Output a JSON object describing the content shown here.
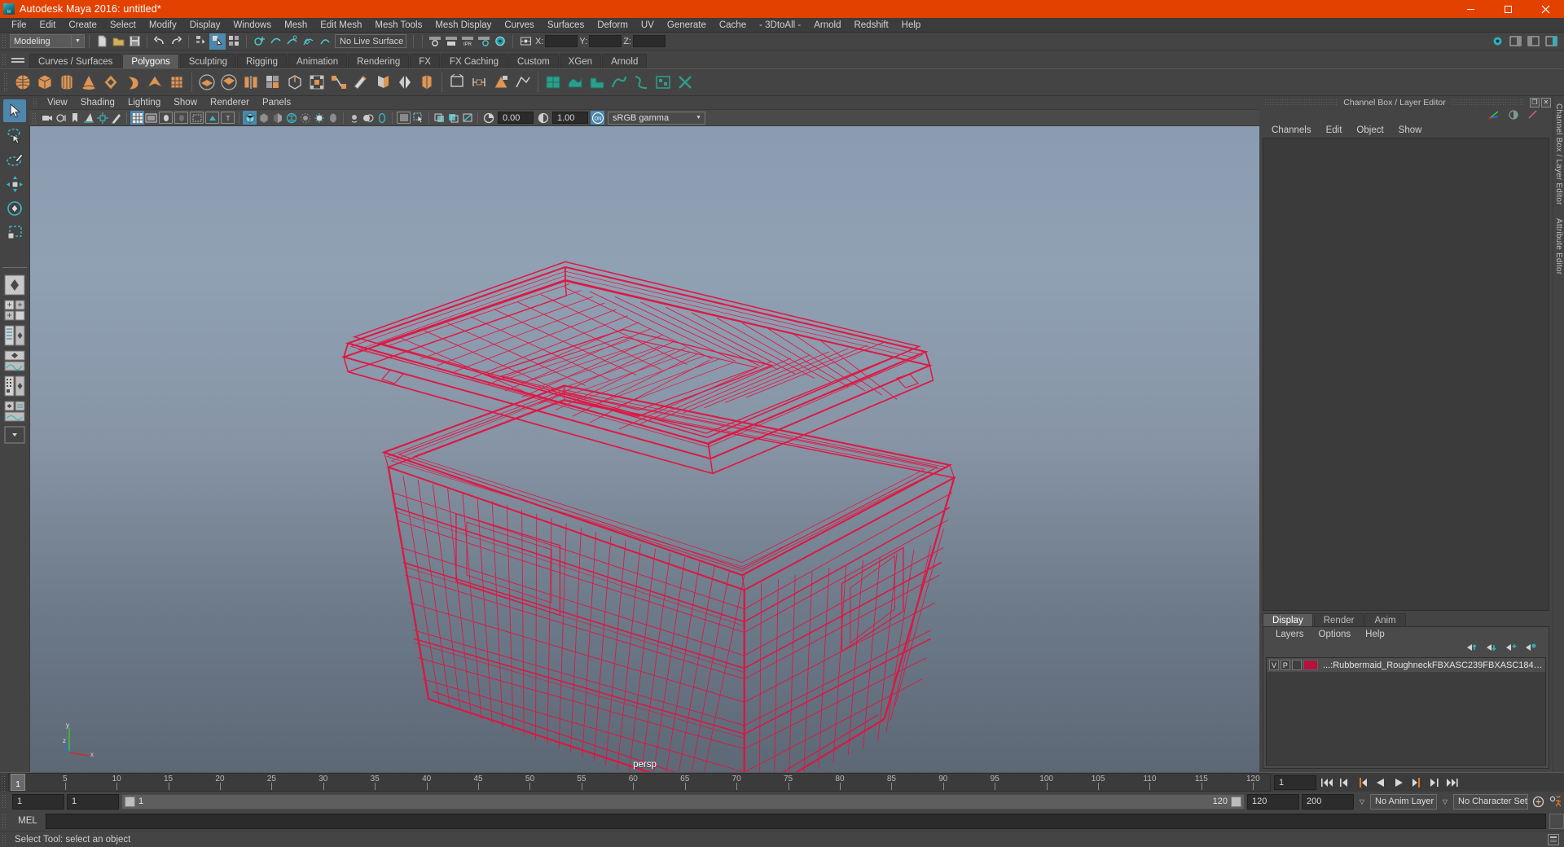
{
  "window": {
    "title": "Autodesk Maya 2016: untitled*",
    "titlebar_color": "#e24100",
    "minimize": "–",
    "maximize": "❐",
    "close": "✕"
  },
  "menubar": {
    "items": [
      "File",
      "Edit",
      "Create",
      "Select",
      "Modify",
      "Display",
      "Windows",
      "Mesh",
      "Edit Mesh",
      "Mesh Tools",
      "Mesh Display",
      "Curves",
      "Surfaces",
      "Deform",
      "UV",
      "Generate",
      "Cache",
      "- 3DtoAll -",
      "Arnold",
      "Redshift",
      "Help"
    ]
  },
  "statusline": {
    "mode": "Modeling",
    "mode_caret": "▼",
    "live_surface": "No Live Surface",
    "x_label": "X:",
    "y_label": "Y:",
    "z_label": "Z:",
    "x_value": "",
    "y_value": "",
    "z_value": ""
  },
  "shelf": {
    "tabs": [
      {
        "label": "Curves / Surfaces",
        "active": false
      },
      {
        "label": "Polygons",
        "active": true
      },
      {
        "label": "Sculpting",
        "active": false
      },
      {
        "label": "Rigging",
        "active": false
      },
      {
        "label": "Animation",
        "active": false
      },
      {
        "label": "Rendering",
        "active": false
      },
      {
        "label": "FX",
        "active": false
      },
      {
        "label": "FX Caching",
        "active": false
      },
      {
        "label": "Custom",
        "active": false
      },
      {
        "label": "XGen",
        "active": false
      },
      {
        "label": "Arnold",
        "active": false
      }
    ],
    "icons": [
      "poly-sphere-icon",
      "poly-cube-icon",
      "poly-cylinder-icon",
      "poly-cone-icon",
      "poly-torus-icon",
      "poly-plane-icon",
      "poly-pyramid-icon",
      "poly-prism-icon",
      "poly-booleans-union-icon",
      "poly-booleans-difference-icon",
      "poly-combine-icon",
      "poly-smooth-icon",
      "poly-extrude-icon",
      "poly-bevel-icon",
      "poly-bridge-icon",
      "poly-append-icon",
      "poly-wedge-icon",
      "poly-mirror-icon",
      "poly-cut-icon",
      "poly-split-icon",
      "poly-insert-edge-loop-icon",
      "poly-quad-draw-icon",
      "uv-planar-icon",
      "uv-cylindrical-icon",
      "uv-spherical-icon",
      "uv-automatic-icon",
      "uv-editor-icon",
      "uv-unfold-icon",
      "uv-layout-icon",
      "uv-cut-icon"
    ]
  },
  "toolbox": {
    "tools": [
      {
        "name": "select-tool",
        "selected": true
      },
      {
        "name": "lasso-select-tool",
        "selected": false
      },
      {
        "name": "paint-select-tool",
        "selected": false
      },
      {
        "name": "move-tool",
        "selected": false
      },
      {
        "name": "rotate-tool",
        "selected": false
      },
      {
        "name": "scale-tool",
        "selected": false
      }
    ],
    "layouts": [
      "single-perspective-layout",
      "four-view-layout",
      "persp-outliner-layout",
      "persp-graph-editor-layout",
      "hypershade-persp-layout",
      "persp-multi-layout",
      "more-layouts"
    ],
    "more_caret": "▼"
  },
  "viewport": {
    "menus": [
      "View",
      "Shading",
      "Lighting",
      "Show",
      "Renderer",
      "Panels"
    ],
    "toolbar": {
      "exposure": "0.00",
      "gamma": "1.00",
      "cm_toggle": "ON",
      "color_space": "sRGB gamma",
      "color_space_caret": "▼",
      "buttons": [
        "select-camera-icon",
        "camera-attributes-icon",
        "bookmarks-icon",
        "image-plane-icon",
        "two-d-pan-zoom-icon",
        "grease-pencil-icon",
        "grid-toggle-icon",
        "film-gate-icon",
        "resolution-gate-icon",
        "gate-mask-icon",
        "film-origin-icon",
        "xray-joints-icon",
        "texture-borders-icon",
        "wireframe-on-shaded-icon",
        "smooth-shade-icon",
        "shaded-wireframe-icon",
        "hardware-texturing-icon",
        "use-all-lights-icon",
        "shadows-icon",
        "screen-space-ao-icon",
        "motion-blur-icon",
        "multisample-icon",
        "depth-of-field-icon",
        "isolate-select-icon",
        "xray-icon",
        "xray-joints2-icon",
        "exposure-icon",
        "gamma-icon",
        "color-management-icon"
      ]
    },
    "camera_label": "persp",
    "axis": {
      "x": "x",
      "y": "y",
      "z": "z"
    },
    "object_color": "#e3123f",
    "bg_top": "#8a9cb0",
    "bg_bottom": "#5d6876"
  },
  "channel_box": {
    "dock_title": "Channel Box / Layer Editor",
    "restore_icon": "❐",
    "close_icon": "✕",
    "menus": [
      "Channels",
      "Edit",
      "Object",
      "Show"
    ],
    "header_icons": [
      "channel-box-icon",
      "attribute-editor-icon",
      "tool-settings-icon"
    ],
    "vertical_tabs": [
      "Channel Box / Layer Editor",
      "Attribute Editor"
    ]
  },
  "layer_editor": {
    "tabs": [
      {
        "label": "Display",
        "active": true
      },
      {
        "label": "Render",
        "active": false
      },
      {
        "label": "Anim",
        "active": false
      }
    ],
    "menus": [
      "Layers",
      "Options",
      "Help"
    ],
    "tool_icons": [
      "move-layer-up-icon",
      "move-layer-down-icon",
      "new-layer-icon",
      "new-layer-from-selected-icon"
    ],
    "layers": [
      {
        "visibility": "V",
        "playback": "P",
        "lock": "",
        "color": "#b3123c",
        "name": "...:Rubbermaid_RoughneckFBXASC239FBXASC184FBXASC"
      }
    ]
  },
  "timeline": {
    "ticks": [
      5,
      10,
      15,
      20,
      25,
      30,
      35,
      40,
      45,
      50,
      55,
      60,
      65,
      70,
      75,
      80,
      85,
      90,
      95,
      100,
      105,
      110,
      115,
      120
    ],
    "start": 1,
    "end": 120,
    "current_frame": "1",
    "current_frame_field": "1",
    "playback_buttons": [
      "go-to-start-icon",
      "step-back-frame-icon",
      "step-back-key-icon",
      "play-backwards-icon",
      "play-forwards-icon",
      "step-forward-key-icon",
      "step-forward-frame-icon",
      "go-to-end-icon"
    ]
  },
  "range": {
    "anim_start": "1",
    "range_start": "1",
    "slider_label_left": "1",
    "slider_label_right": "120",
    "range_end": "120",
    "anim_end": "200",
    "anim_layer": "No Anim Layer",
    "character_set": "No Character Set",
    "caret": "▽",
    "auto_key_icon": "auto-keyframe-icon",
    "anim_prefs_icon": "animation-preferences-icon"
  },
  "command_line": {
    "language": "MEL",
    "input_value": "",
    "script_editor_icon": "script-editor-icon"
  },
  "status_bar": {
    "message": "Select Tool: select an object",
    "help_icon": "help-line-icon"
  }
}
